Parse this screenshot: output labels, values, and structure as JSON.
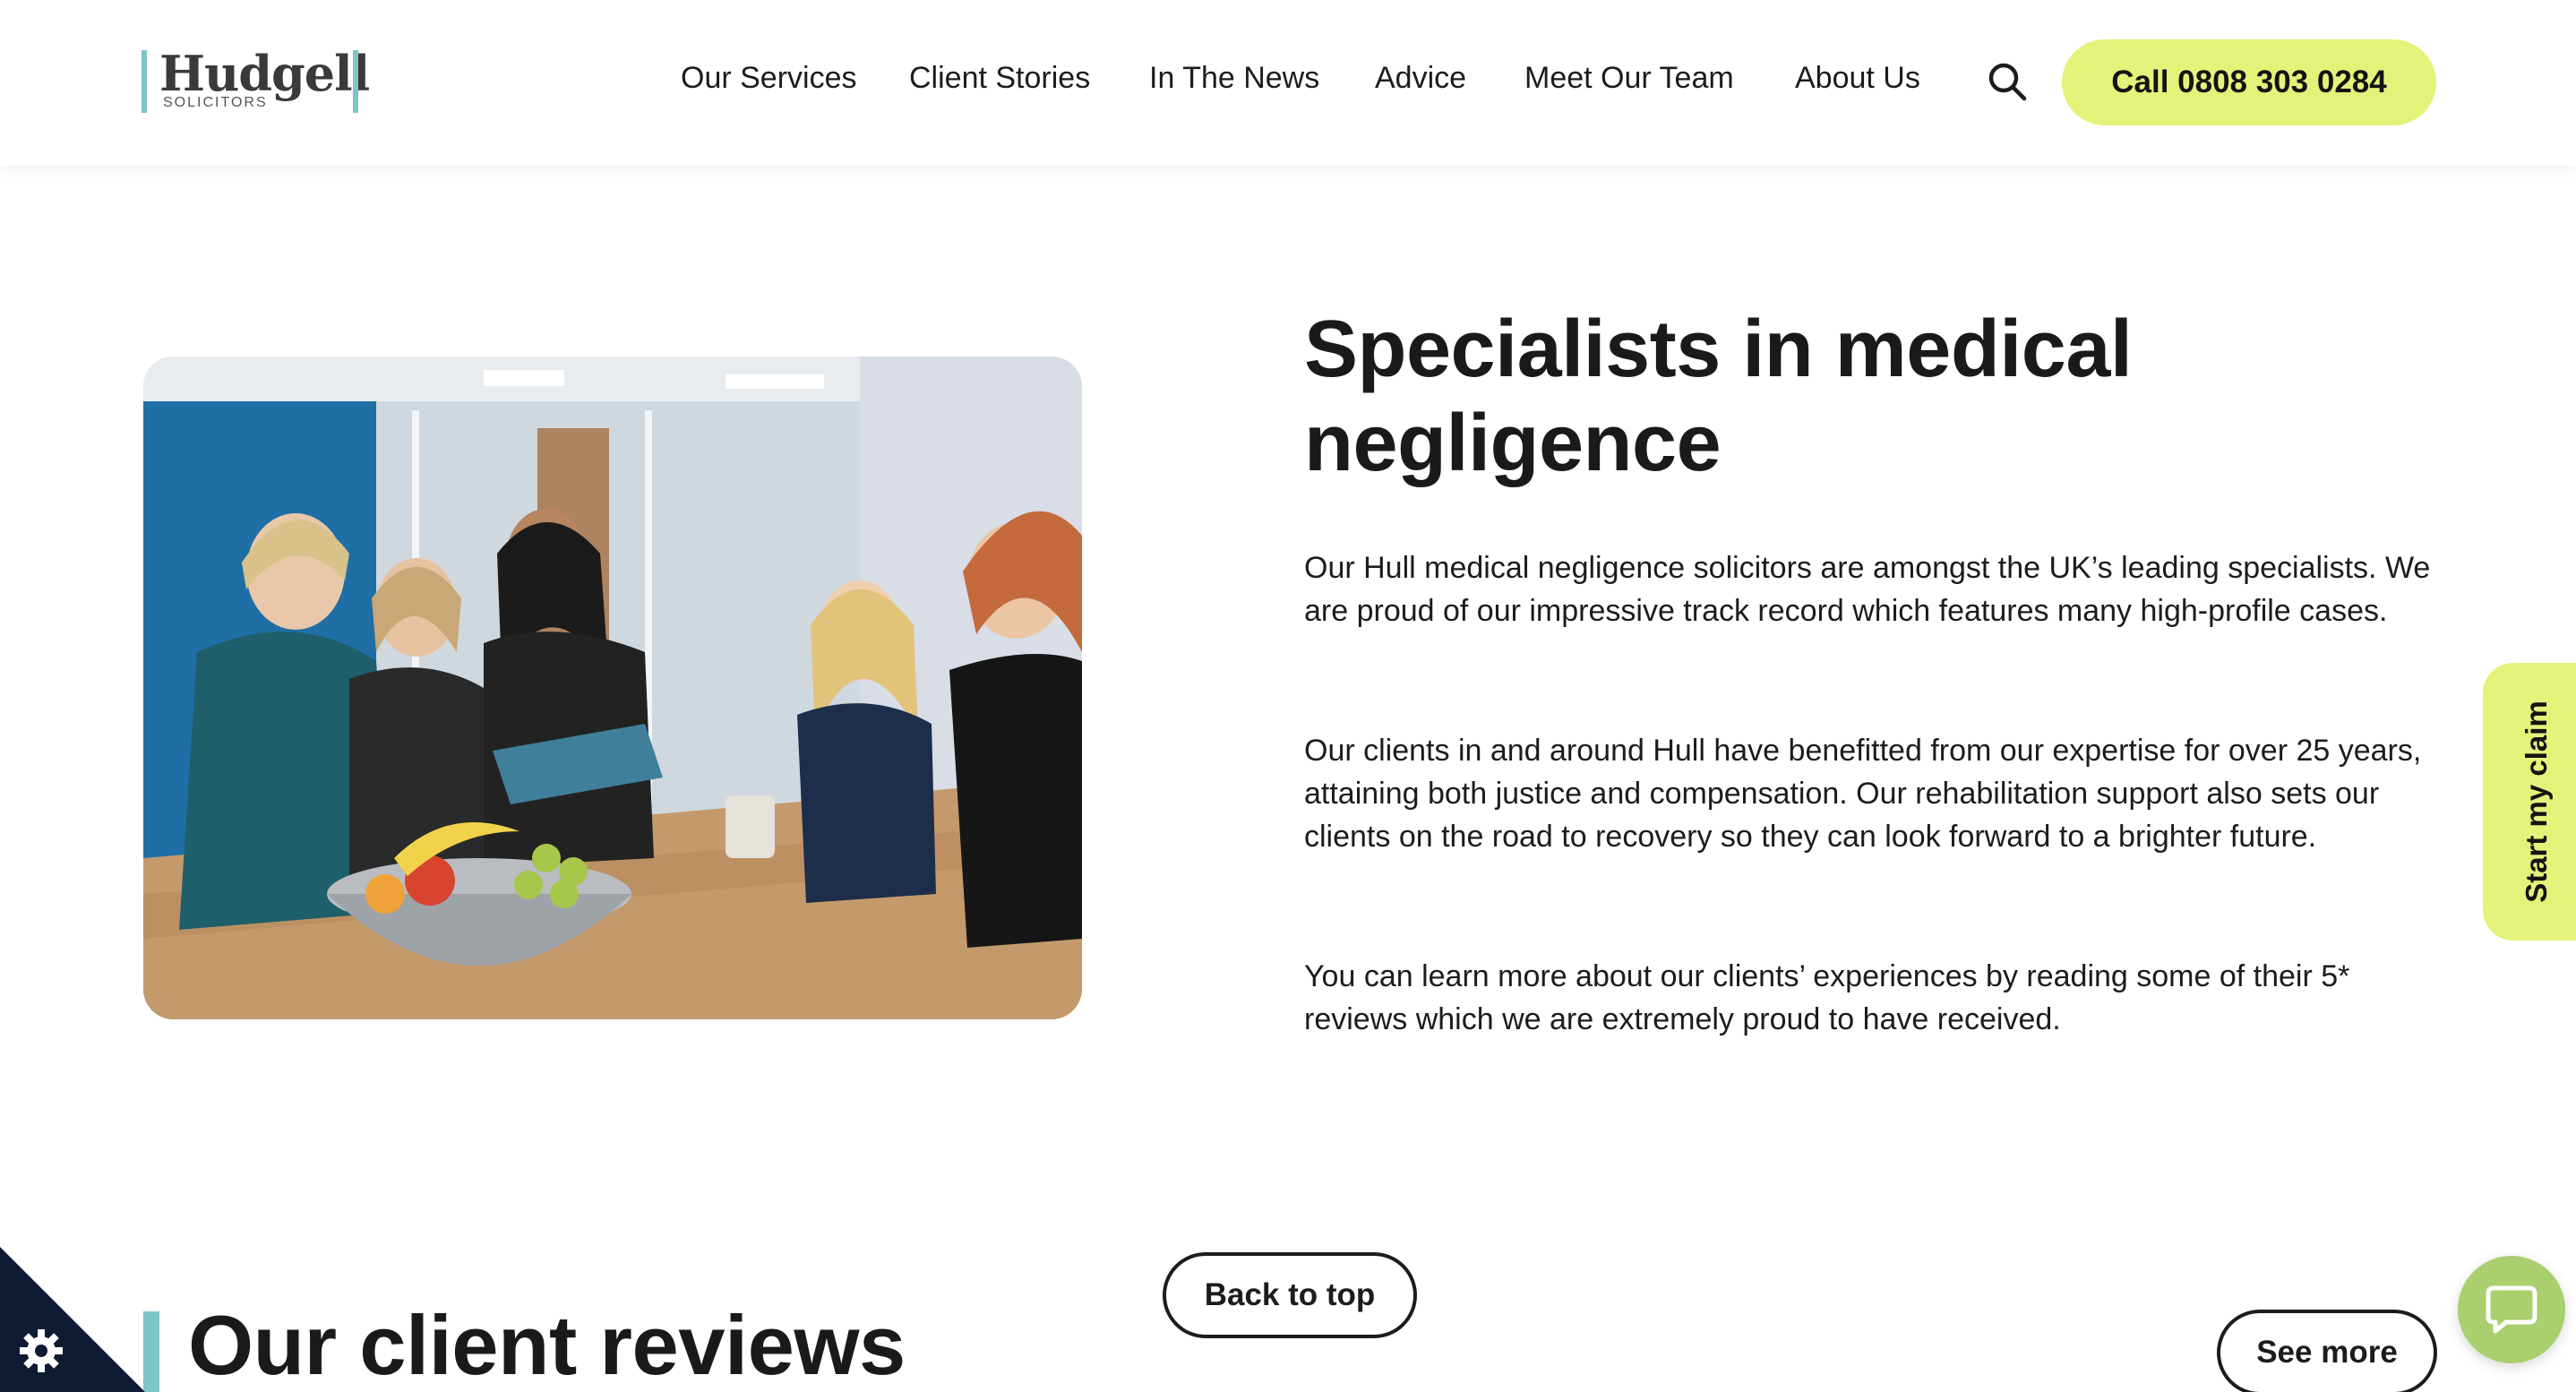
{
  "brand": {
    "name": "Hudgell",
    "tagline": "SOLICITORS",
    "accent_color": "#7ec4c8",
    "cta_color": "#e4f27a"
  },
  "nav": {
    "items": [
      {
        "label": "Our Services"
      },
      {
        "label": "Client Stories"
      },
      {
        "label": "In The News"
      },
      {
        "label": "Advice"
      },
      {
        "label": "Meet Our Team"
      },
      {
        "label": "About Us"
      }
    ],
    "search_icon": "search-icon",
    "call_label": "Call 0808 303 0284"
  },
  "hero": {
    "image_alt": "office-meeting-photo",
    "title_line1": "Specialists in medical",
    "title_line2": "negligence",
    "paragraphs": [
      "Our Hull medical negligence solicitors are amongst the UK’s leading specialists. We are proud of our impressive track record which features many high-profile cases.",
      "Our clients in and around Hull have benefitted from our expertise for over 25 years, attaining both justice and compensation. Our rehabilitation support also sets our clients on the road to recovery so they can look forward to a brighter future.",
      "You can learn more about our clients’ experiences by reading some of their 5* reviews which we are extremely proud to have received."
    ]
  },
  "side_tab": {
    "label": "Start my claim"
  },
  "reviews": {
    "title": "Our client reviews",
    "see_more_label": "See more"
  },
  "back_to_top_label": "Back to top",
  "widgets": {
    "cookie_icon": "gear-icon",
    "chat_icon": "chat-bubble-icon"
  }
}
